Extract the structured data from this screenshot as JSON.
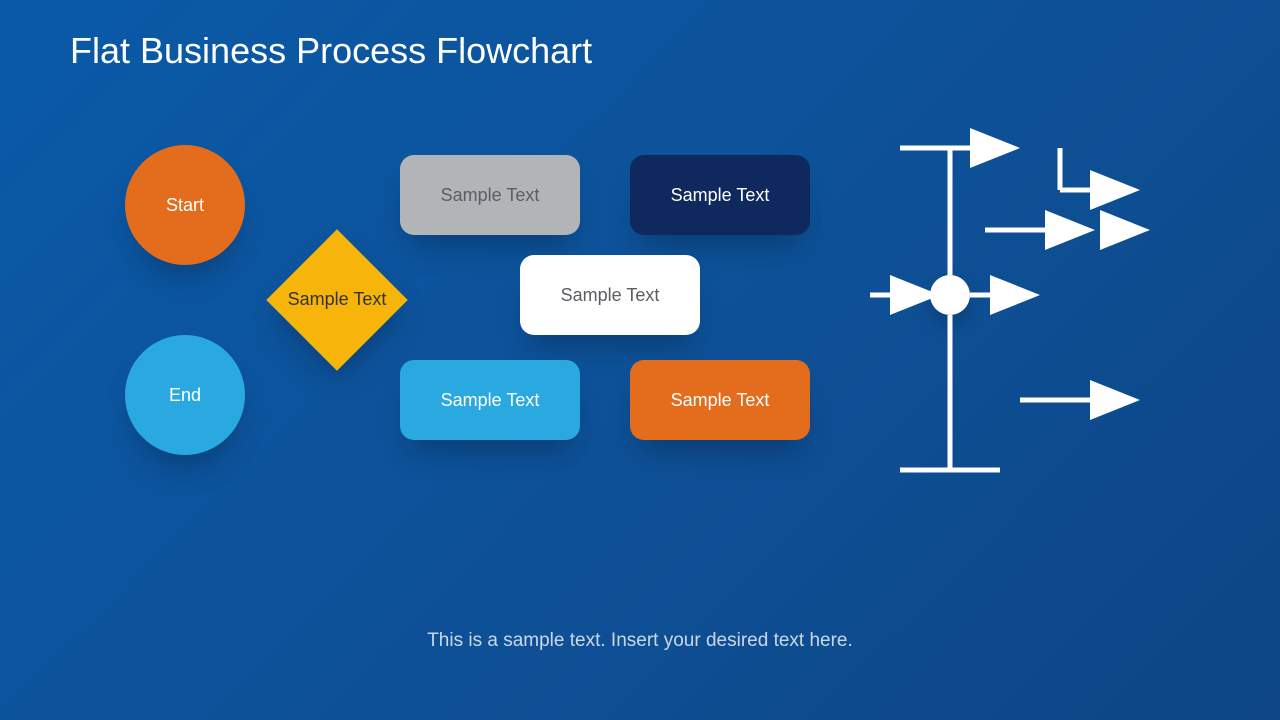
{
  "title": "Flat Business Process Flowchart",
  "shapes": {
    "start": "Start",
    "end": "End",
    "diamond": "Sample Text",
    "box_gray": "Sample Text",
    "box_navy": "Sample Text",
    "box_white": "Sample Text",
    "box_lightblue": "Sample Text",
    "box_orange": "Sample Text"
  },
  "footer": "This is a sample text. Insert your desired text here.",
  "colors": {
    "bg": "#0e5aa5",
    "orange": "#e36d1d",
    "lightblue": "#2aa8e0",
    "yellow": "#f7b50c",
    "gray": "#b2b5b8",
    "navy": "#0f285e",
    "white": "#ffffff"
  }
}
